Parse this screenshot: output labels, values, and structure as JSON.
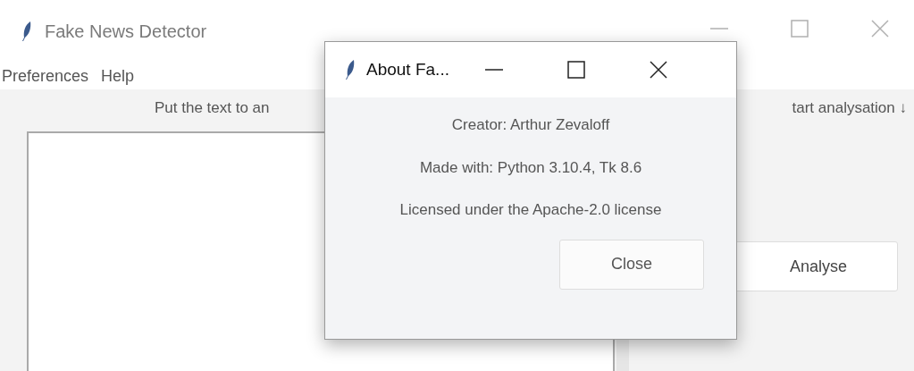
{
  "window": {
    "title": "Fake News Detector"
  },
  "menu": [
    "Preferences",
    "Help"
  ],
  "input_panel": {
    "label": "Put the text to an"
  },
  "action_panel": {
    "label": "tart analysation ↓",
    "button": "Analyse"
  },
  "about_dialog": {
    "title": "About Fa...",
    "lines": [
      "Creator: Arthur Zevaloff",
      "Made with: Python 3.10.4, Tk 8.6",
      "Licensed under the Apache-2.0 license"
    ],
    "button": "Close"
  }
}
